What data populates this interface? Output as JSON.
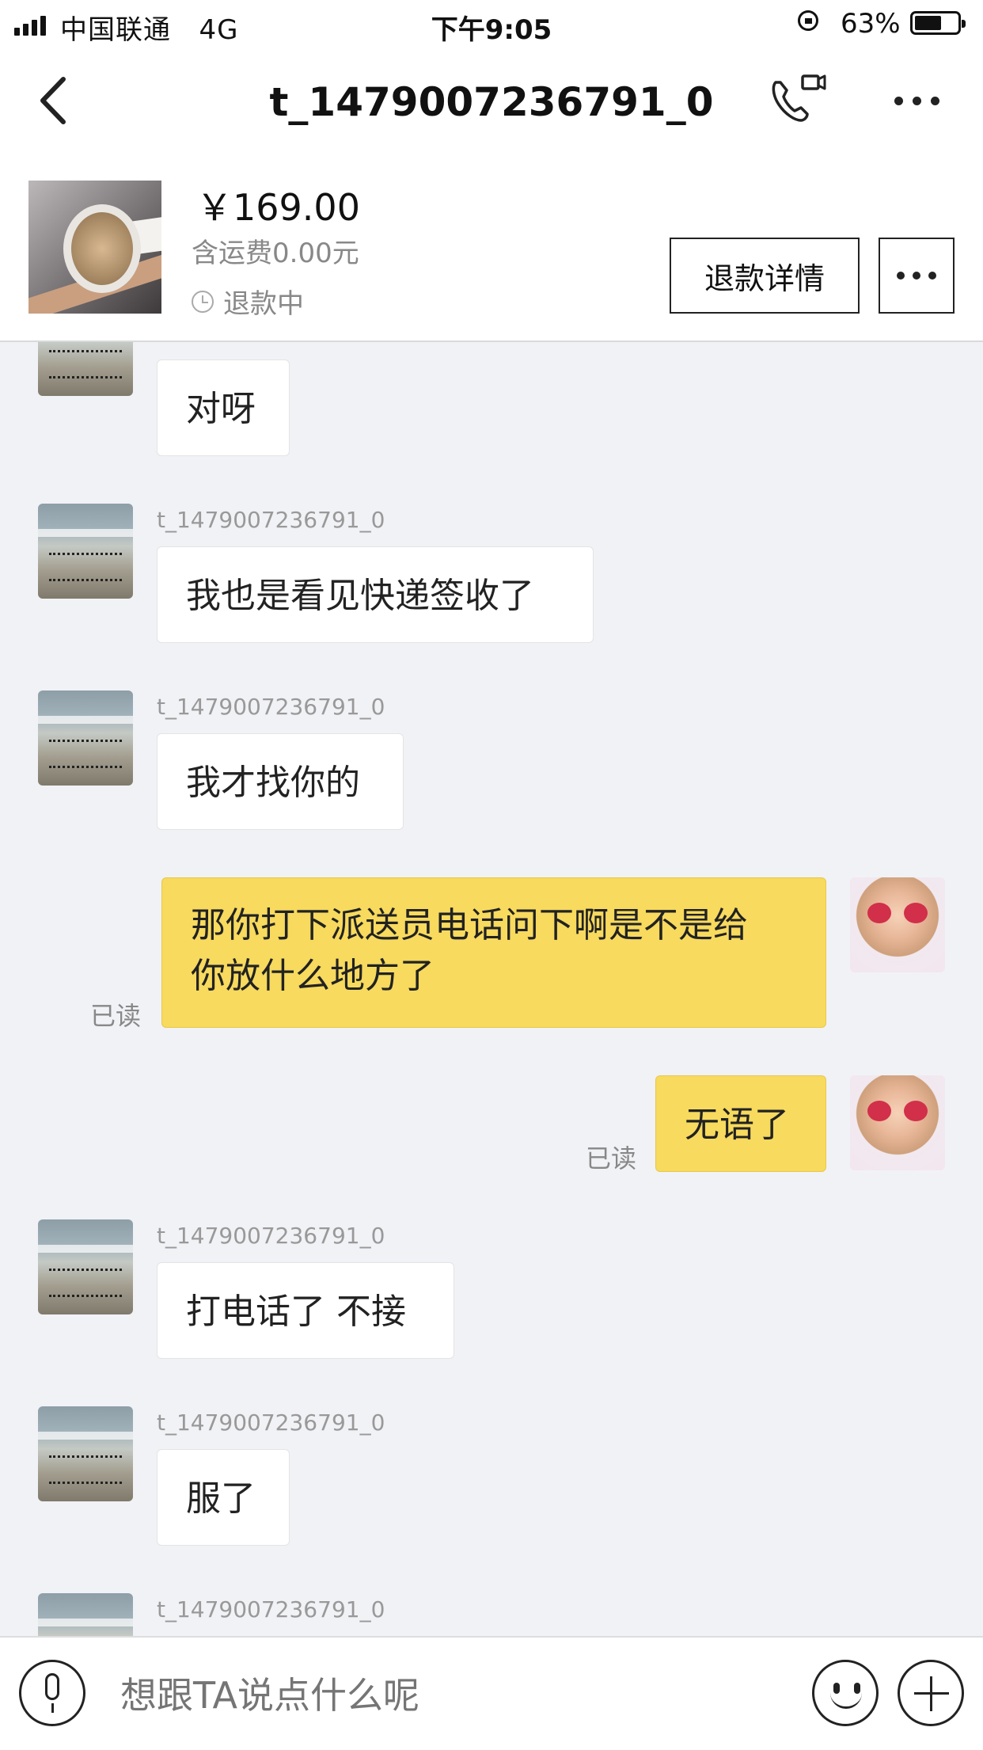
{
  "status_bar": {
    "carrier": "中国联通",
    "network": "4G",
    "time": "下午9:05",
    "battery_percent": "63%",
    "battery_level": 0.63
  },
  "nav": {
    "title": "t_1479007236791_0"
  },
  "product": {
    "price": "￥169.00",
    "shipping": "含运费0.00元",
    "status": "退款中",
    "refund_button": "退款详情"
  },
  "messages": [
    {
      "from": "other",
      "sender": "",
      "text": "对呀"
    },
    {
      "from": "other",
      "sender": "t_1479007236791_0",
      "text": "我也是看见快递签收了"
    },
    {
      "from": "other",
      "sender": "t_1479007236791_0",
      "text": "我才找你的"
    },
    {
      "from": "me",
      "read_label": "已读",
      "text_line1": "那你打下派送员电话问下啊是不是给",
      "text_line2": "你放什么地方了"
    },
    {
      "from": "me",
      "read_label": "已读",
      "text": "无语了"
    },
    {
      "from": "other",
      "sender": "t_1479007236791_0",
      "text": "打电话了 不接"
    },
    {
      "from": "other",
      "sender": "t_1479007236791_0",
      "text": "服了"
    },
    {
      "from": "other",
      "sender": "t_1479007236791_0",
      "text": ""
    }
  ],
  "input_bar": {
    "placeholder": "想跟TA说点什么呢"
  }
}
